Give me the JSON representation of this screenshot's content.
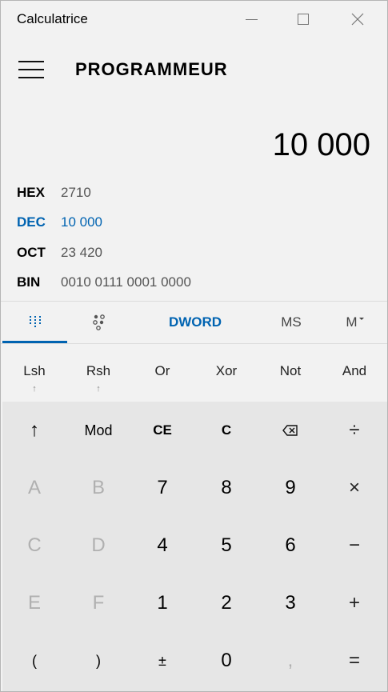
{
  "window": {
    "title": "Calculatrice"
  },
  "header": {
    "mode": "PROGRAMMEUR"
  },
  "display": {
    "value": "10 000"
  },
  "radix": [
    {
      "label": "HEX",
      "value": "2710",
      "active": false
    },
    {
      "label": "DEC",
      "value": "10 000",
      "active": true
    },
    {
      "label": "OCT",
      "value": "23 420",
      "active": false
    },
    {
      "label": "BIN",
      "value": "0010 0111 0001 0000",
      "active": false
    }
  ],
  "tabs": {
    "word_size": "DWORD",
    "memory_store": "MS",
    "memory_list": "M"
  },
  "bitwise": [
    {
      "label": "Lsh",
      "arrow": "↑"
    },
    {
      "label": "Rsh",
      "arrow": "↑"
    },
    {
      "label": "Or",
      "arrow": ""
    },
    {
      "label": "Xor",
      "arrow": ""
    },
    {
      "label": "Not",
      "arrow": ""
    },
    {
      "label": "And",
      "arrow": ""
    }
  ],
  "keys": [
    [
      "↑",
      "Mod",
      "CE",
      "C",
      "⌫",
      "÷"
    ],
    [
      "A",
      "B",
      "7",
      "8",
      "9",
      "×"
    ],
    [
      "C",
      "D",
      "4",
      "5",
      "6",
      "−"
    ],
    [
      "E",
      "F",
      "1",
      "2",
      "3",
      "+"
    ],
    [
      "(",
      ")",
      "±",
      "0",
      ",",
      "="
    ]
  ],
  "colors": {
    "accent": "#0063b1",
    "keypad_bg": "#e6e6e6",
    "window_bg": "#f2f2f2",
    "disabled": "#b0b0b0"
  }
}
